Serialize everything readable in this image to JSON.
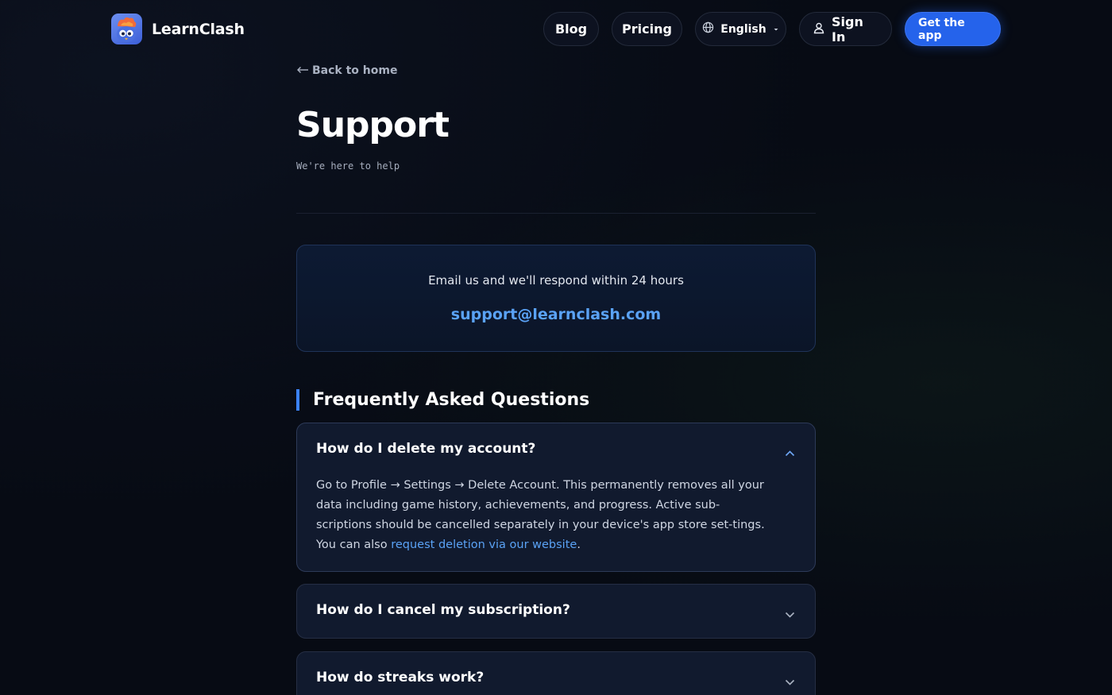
{
  "header": {
    "brand": "LearnClash",
    "nav": {
      "blog": "Blog",
      "pricing": "Pricing",
      "language": "English",
      "sign_in": "Sign In",
      "cta": "Get the app"
    }
  },
  "page": {
    "back_link": "Back to home",
    "title": "Support",
    "subtitle": "We're here to help"
  },
  "contact": {
    "text": "Email us and we'll respond within 24 hours",
    "email": "support@learnclash.com"
  },
  "faq": {
    "heading": "Frequently Asked Questions",
    "items": [
      {
        "question": "How do I delete my account?",
        "expanded": true,
        "answer_prefix": "Go to Profile → Settings → Delete Account. This permanently removes all your data including game history, achievements, and progress. Active sub-scriptions should be cancelled separately in your device's app store set-tings. You can also ",
        "answer_link": "request deletion via our website",
        "answer_suffix": "."
      },
      {
        "question": "How do I cancel my subscription?",
        "expanded": false
      },
      {
        "question": "How do streaks work?",
        "expanded": false
      }
    ]
  },
  "colors": {
    "background": "#070b14",
    "accent": "#2563eb",
    "link": "#5aa2f5",
    "card": "#111a2e"
  },
  "icons": [
    "learnclash-logo",
    "globe-icon",
    "caret-down-icon",
    "user-icon",
    "arrow-left-icon",
    "chevron-up-icon",
    "chevron-down-icon"
  ]
}
